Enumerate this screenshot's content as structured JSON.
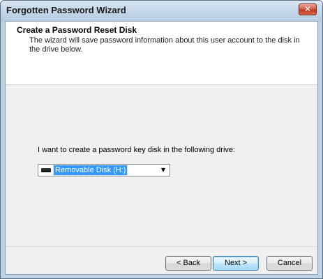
{
  "window": {
    "title": "Forgotten Password Wizard",
    "close_glyph": "✕"
  },
  "header": {
    "title": "Create a Password Reset Disk",
    "description": "The wizard will save password information about this user account to the disk in the drive below."
  },
  "main": {
    "prompt": "I want to create a password key disk in the following drive:",
    "drive_select": {
      "selected": "Removable Disk (H:)",
      "icon": "removable-drive-icon",
      "arrow": "▼"
    }
  },
  "buttons": {
    "back": "< Back",
    "next": "Next >",
    "cancel": "Cancel"
  }
}
